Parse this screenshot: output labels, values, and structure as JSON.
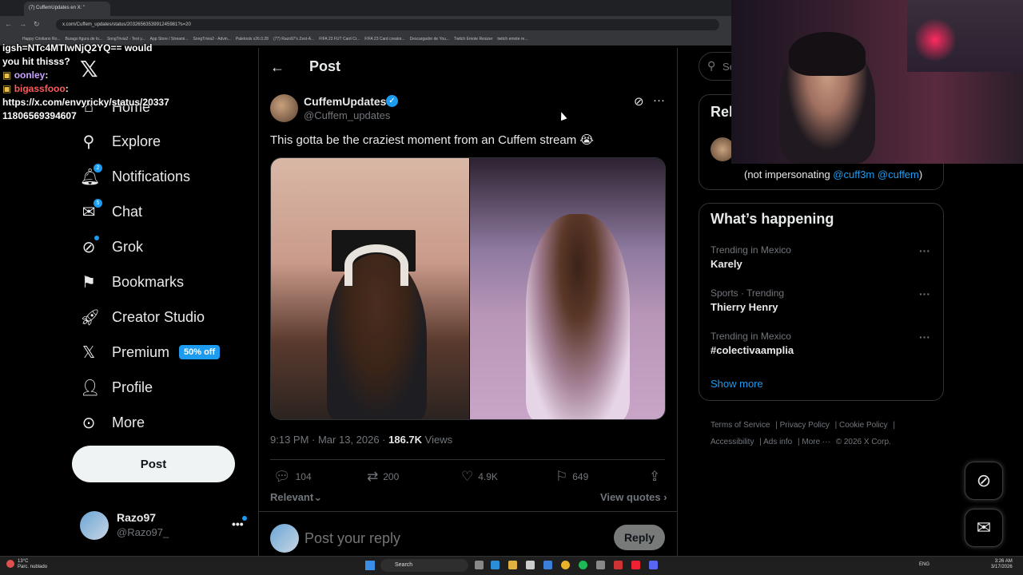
{
  "browser": {
    "tab_title": "(7) CuffemUpdates en X: \"",
    "url": "x.com/Cuffem_updates/status/2032656353991245981?s=20",
    "bookmarks": [
      "Happy Cristiano Ro...",
      "Burago figura de lo...",
      "SongTrivia2 - Test y...",
      "App Store / Streami...",
      "SongTrivia2 - Advin...",
      "Paletools v26.0.28",
      "(77) Razo97's Zest-A...",
      "FIFA 23 FUT Card Cr...",
      "FIFA 23 Card creator...",
      "Descargador de You...",
      "Twitch Emote Resizer",
      "twitch emote re..."
    ]
  },
  "chat_overlay": {
    "line1": "igsh=NTc4MTIwNjQ2YQ== would",
    "line2": "you hit thisss?",
    "user1": "oonley",
    "user2": "bigassfooo",
    "link": "https://x.com/envyricky/status/2033711806569394607"
  },
  "sidebar": {
    "logo": "𝕏",
    "items": [
      {
        "label": "Home",
        "icon": "home-icon"
      },
      {
        "label": "Explore",
        "icon": "search-icon"
      },
      {
        "label": "Notifications",
        "icon": "bell-icon",
        "badge": "2"
      },
      {
        "label": "Chat",
        "icon": "mail-icon",
        "badge": "5"
      },
      {
        "label": "Grok",
        "icon": "grok-icon"
      },
      {
        "label": "Bookmarks",
        "icon": "bookmark-icon"
      },
      {
        "label": "Creator Studio",
        "icon": "rocket-icon"
      },
      {
        "label": "Premium",
        "icon": "x-logo-icon",
        "pill": "50% off"
      },
      {
        "label": "Profile",
        "icon": "person-icon"
      },
      {
        "label": "More",
        "icon": "more-circle-icon"
      }
    ],
    "post_button": "Post",
    "account": {
      "name": "Razo97",
      "handle": "@Razo97_"
    }
  },
  "header": {
    "title": "Post"
  },
  "tweet": {
    "author": "CuffemUpdates",
    "handle": "@Cuffem_updates",
    "text": "This gotta be the craziest moment from an Cuffem stream 😭",
    "time": "9:13 PM · Mar 13, 2026 · ",
    "views": "186.7K",
    "views_label": " Views",
    "replies": "104",
    "reposts": "200",
    "likes": "4.9K",
    "bookmarks": "649",
    "sort": "Relevant",
    "view_quotes": "View quotes"
  },
  "reply": {
    "placeholder": "Post your reply",
    "button": "Reply"
  },
  "right": {
    "search_placeholder": "Se",
    "relevant_title": "Rel",
    "bio_prefix": "(not impersonating ",
    "bio_link1": "@cuff3m",
    "bio_link2": "@cuffem",
    "bio_suffix": ")",
    "trending_title": "What’s happening",
    "trends": [
      {
        "context": "Trending in Mexico",
        "name": "Karely"
      },
      {
        "context": "Sports · Trending",
        "name": "Thierry Henry"
      },
      {
        "context": "Trending in Mexico",
        "name": "#colectivaamplia"
      }
    ],
    "show_more": "Show more",
    "footer": [
      "Terms of Service",
      "Privacy Policy",
      "Cookie Policy",
      "Accessibility",
      "Ads info",
      "More ···",
      "© 2026 X Corp."
    ]
  },
  "taskbar": {
    "weather_temp": "13°C",
    "weather_desc": "Parc. nublado",
    "search": "Search",
    "lang": "ENG",
    "time": "3:26 AM",
    "date": "3/17/2026"
  },
  "colors": {
    "accent": "#1d9bf0",
    "background": "#000000",
    "border": "#2f3336",
    "muted": "#71767b"
  }
}
